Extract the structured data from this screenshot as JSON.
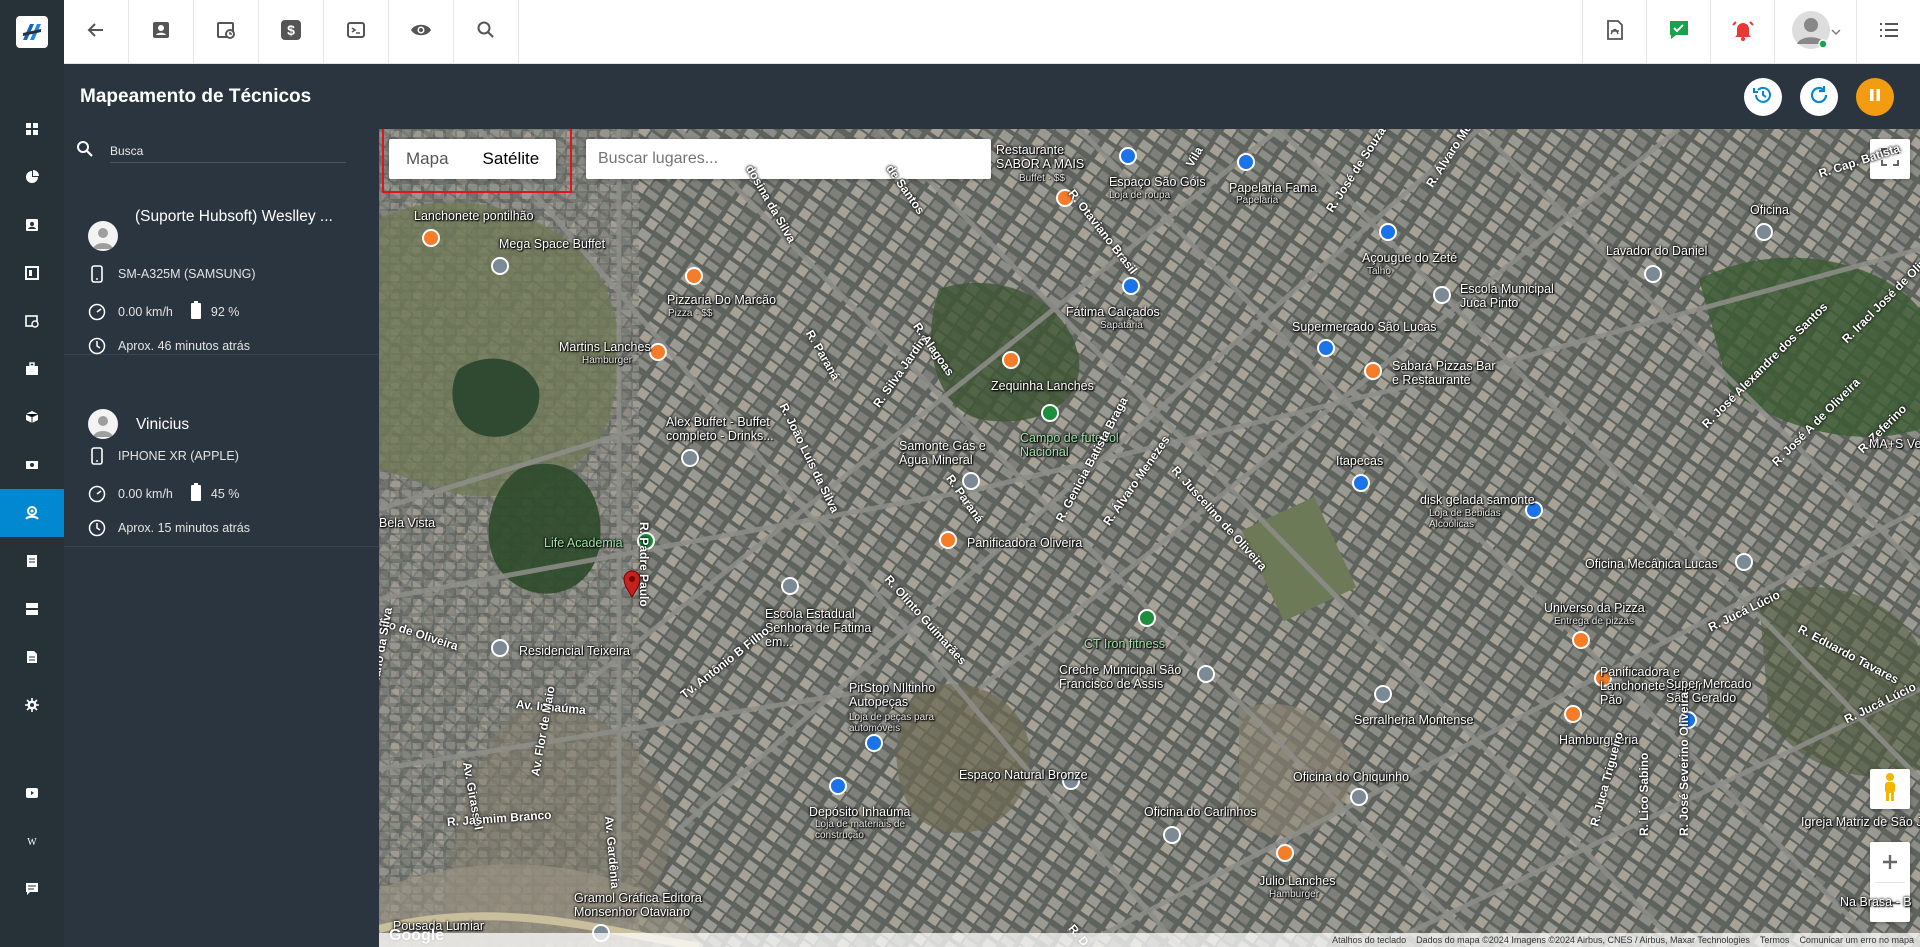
{
  "header": {
    "title": "Mapeamento de Técnicos"
  },
  "search": {
    "placeholder": "Busca"
  },
  "technicians": [
    {
      "name": "(Suporte Hubsoft) Weslley ...",
      "device": "SM-A325M (SAMSUNG)",
      "speed": "0.00 km/h",
      "battery": "92 %",
      "last_seen": "Aprox. 46 minutos atrás"
    },
    {
      "name": "Vinicius",
      "device": "IPHONE XR (APPLE)",
      "speed": "0.00 km/h",
      "battery": "45 %",
      "last_seen": "Aprox. 15 minutos atrás"
    }
  ],
  "map": {
    "type_map": "Mapa",
    "type_satellite": "Satélite",
    "places_placeholder": "Buscar lugares...",
    "google": "Google",
    "footer": {
      "shortcuts": "Atalhos do teclado",
      "data": "Dados do mapa ©2024 Imagens ©2024 Airbus, CNES / Airbus, Maxar Technologies",
      "terms": "Termos",
      "report": "Comunicar um erro no mapa"
    },
    "places": [
      {
        "n": "Lanchonete pontilhão",
        "c": "o"
      },
      {
        "n": "Mega Space Buffet",
        "c": "gr"
      },
      {
        "n": "Pizzaria Do Marcão",
        "c": "o"
      },
      {
        "n": "Martins Lanches",
        "c": "o"
      },
      {
        "n": "Alex Buffet - Buffet completo - Drinks...",
        "c": "gr"
      },
      {
        "n": "Life Academia",
        "c": "g"
      },
      {
        "n": "Residencial Teixeira",
        "c": "gr"
      },
      {
        "n": "Escola Estadual Senhora de Fatima em...",
        "c": "gr"
      },
      {
        "n": "PitStop NIltinho Autopeças",
        "c": "b"
      },
      {
        "n": "Depósito Inhaúma",
        "c": "b"
      },
      {
        "n": "Gramol Gráfica Editora Monsenhor Otaviano",
        "c": "gr"
      },
      {
        "n": "Restaurante SABOR A MAIS",
        "c": "o"
      },
      {
        "n": "Espaço São Góis",
        "c": "b"
      },
      {
        "n": "Papelaria Fama",
        "c": "b"
      },
      {
        "n": "Fátima Calçados",
        "c": "b"
      },
      {
        "n": "Zequinha Lanches",
        "c": "o"
      },
      {
        "n": "Campo de futebol Nacional",
        "c": "g"
      },
      {
        "n": "Samonte Gás e Água Mineral",
        "c": "gr"
      },
      {
        "n": "Panificadora Oliveira",
        "c": "o"
      },
      {
        "n": "CT Iron fitness",
        "c": "g"
      },
      {
        "n": "Creche Municipal São Francisco de Assis",
        "c": "gr"
      },
      {
        "n": "Espaço Natural Bronze",
        "c": "gr"
      },
      {
        "n": "Oficina do Carlinhos",
        "c": "gr"
      },
      {
        "n": "Oficina do Chiquinho",
        "c": "gr"
      },
      {
        "n": "Julio Lanches",
        "c": "o"
      },
      {
        "n": "Serralheria Montense",
        "c": "gr"
      },
      {
        "n": "Açougue do Zeté",
        "c": "b"
      },
      {
        "n": "Escola Municipal Juca Pinto",
        "c": "gr"
      },
      {
        "n": "Supermercado São Lucas",
        "c": "b"
      },
      {
        "n": "Sabará Pizzas Bar e Restaurante",
        "c": "o"
      },
      {
        "n": "Itapecas",
        "c": "b"
      },
      {
        "n": "disk gelada samonte",
        "c": "b"
      },
      {
        "n": "Lavador do Daniel",
        "c": "gr"
      },
      {
        "n": "Oficina",
        "c": "gr"
      },
      {
        "n": "Oficina Mecânica Lucas",
        "c": "gr"
      },
      {
        "n": "Universo da Pizza",
        "c": "o"
      },
      {
        "n": "Panificadora e Lanchonete Super Pão",
        "c": "o"
      },
      {
        "n": "Super Mercado São Geraldo",
        "c": "b"
      },
      {
        "n": "Hamburgueria",
        "c": "o"
      },
      {
        "n": "Igreja Matriz de São José",
        "c": "gr"
      },
      {
        "n": "Pousada Lumiar",
        "c": "gr"
      }
    ],
    "sublabels": [
      "Pizza · $$",
      "Hamburger",
      "Buffet · $$",
      "Loja de roupa",
      "Papelaria",
      "Sapataria",
      "Talho",
      "Loja de peças para automóveis",
      "Loja de materiais de construção",
      "Entrega de pizzas",
      "Hamburger",
      "Loja de Bebidas Alcoólicas"
    ],
    "streets": [
      "R. João Luís da Silva",
      "R. Paraná",
      "R. Silva Jardim",
      "R. Alagoas",
      "R. Padre Paulo",
      "R. Olinto Guimarães",
      "R. Genicia Batista Braga",
      "R. Álvaro Menezes",
      "R. Juscelino de Oliveira",
      "R. Otaviano Brasil",
      "R. José de Souza",
      "R. Álvaro Menezes",
      "R. Cap. Batista",
      "R. José Alexandre dos Santos",
      "R. Iracl José de Oliveira",
      "R. José A de Oliveira",
      "R. Zeferino",
      "R. Eduardo Tavares",
      "R. Jucá Lúcio",
      "R. Jucá Lúcio",
      "R. Juca Trigueiro",
      "R. Lico Sabino",
      "R. José Severino Oliveira",
      "Av. Inhaúma",
      "Av. Girassol",
      "Av. Flor de Maio",
      "Av. Gardênia",
      "R. Jasmim Branco",
      "Tv. Antônio B Filho",
      "tijo de Oliveira",
      "R. Luciano da Silva",
      "R. Paraná",
      "Bela Vista",
      "Vila",
      "dosina da Silva",
      "de Santos",
      "Na Brasa - B",
      "MA+S Vend",
      "R. D"
    ]
  },
  "colors": {
    "accent": "#0288d1",
    "sidebar": "#263238",
    "header": "#2b353f",
    "orange_button": "#f39c12",
    "highlight": "#e0141e"
  },
  "icons": [
    "back-arrow-icon",
    "contact-card-icon",
    "clock-calendar-icon",
    "dollar-icon",
    "terminal-icon",
    "eye-icon",
    "search-icon",
    "pdf-icon",
    "chat-check-icon",
    "alarm-bell-icon",
    "user-avatar",
    "list-menu-icon",
    "history-icon",
    "refresh-icon",
    "pause-icon"
  ]
}
